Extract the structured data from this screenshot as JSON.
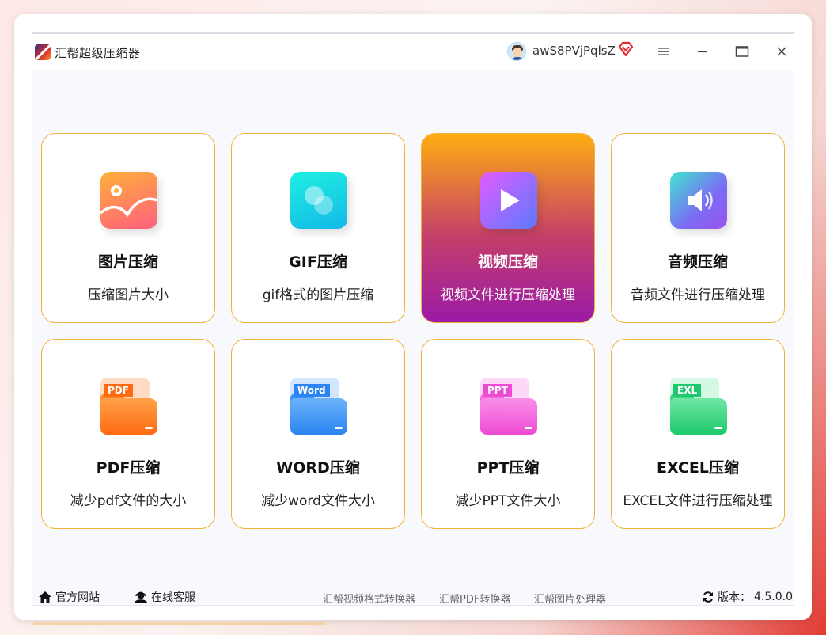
{
  "app": {
    "title": "汇帮超级压缩器",
    "username": "awS8PVjPqlsZ",
    "vip_icon": "vip-diamond-icon"
  },
  "window_controls": {
    "menu": "hamburger-menu-icon",
    "minimize": "minimize-icon",
    "maximize": "maximize-icon",
    "close": "close-icon"
  },
  "tools": [
    {
      "id": "image",
      "name": "图片压缩",
      "desc": "压缩图片大小",
      "icon": "image-icon",
      "active": false
    },
    {
      "id": "gif",
      "name": "GIF压缩",
      "desc": "gif格式的图片压缩",
      "icon": "gif-icon",
      "active": false
    },
    {
      "id": "video",
      "name": "视频压缩",
      "desc": "视频文件进行压缩处理",
      "icon": "video-play-icon",
      "active": true
    },
    {
      "id": "audio",
      "name": "音频压缩",
      "desc": "音频文件进行压缩处理",
      "icon": "speaker-icon",
      "active": false
    },
    {
      "id": "pdf",
      "name": "PDF压缩",
      "desc": "减少pdf文件的大小",
      "icon": "pdf-folder-icon",
      "badge": "PDF",
      "active": false
    },
    {
      "id": "word",
      "name": "WORD压缩",
      "desc": "减少word文件大小",
      "icon": "word-folder-icon",
      "badge": "Word",
      "active": false
    },
    {
      "id": "ppt",
      "name": "PPT压缩",
      "desc": "减少PPT文件大小",
      "icon": "ppt-folder-icon",
      "badge": "PPT",
      "active": false
    },
    {
      "id": "excel",
      "name": "EXCEL压缩",
      "desc": "EXCEL文件进行压缩处理",
      "icon": "excel-folder-icon",
      "badge": "EXL",
      "active": false
    }
  ],
  "footer": {
    "website": "官方网站",
    "support": "在线客服",
    "links": [
      "汇帮视频格式转换器",
      "汇帮PDF转换器",
      "汇帮图片处理器"
    ],
    "version_label": "版本：",
    "version": "4.5.0.0"
  },
  "colors": {
    "card_border": "#f1b23a",
    "active_gradient_top": "#ffad12",
    "active_gradient_bottom": "#9a1aa6",
    "pdf": "#ff7a1a",
    "word": "#2f8ff5",
    "ppt": "#f25bd8",
    "excel": "#2bd37a"
  }
}
